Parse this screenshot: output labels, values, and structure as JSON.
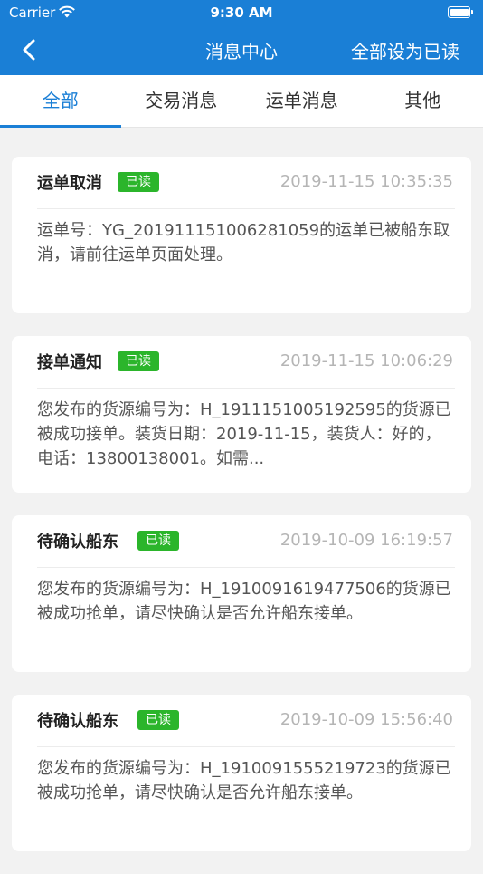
{
  "status_bar": {
    "carrier": "Carrier",
    "time": "9:30 AM"
  },
  "nav": {
    "title": "消息中心",
    "action": "全部设为已读"
  },
  "tabs": [
    {
      "label": "全部",
      "active": true
    },
    {
      "label": "交易消息",
      "active": false
    },
    {
      "label": "运单消息",
      "active": false
    },
    {
      "label": "其他",
      "active": false
    }
  ],
  "messages": [
    {
      "title": "运单取消",
      "badge": "已读",
      "time": "2019-11-15 10:35:35",
      "body": "运单号：YG_20191115100628105​9的运单已被船东取消，请前往运单页面处理。"
    },
    {
      "title": "接单通知",
      "badge": "已读",
      "time": "2019-11-15 10:06:29",
      "body": "您发布的货源编号为：H_1911151005192595的货源已被成功接单。装货日期：2019-11-15，装货人：好的，电话：13800138001。如需..."
    },
    {
      "title": "待确认船东",
      "badge": "已读",
      "time": "2019-10-09 16:19:57",
      "body": "您发布的货源编号为：H_1910091619477506的货源已被成功抢单，请尽快确认是否允许船东接单。"
    },
    {
      "title": "待确认船东",
      "badge": "已读",
      "time": "2019-10-09 15:56:40",
      "body": "您发布的货源编号为：H_1910091555219723的货源已被成功抢单，请尽快确认是否允许船东接单。"
    }
  ],
  "colors": {
    "primary": "#1a7fd6",
    "badge": "#2bb52b",
    "background": "#f2f2f2"
  }
}
